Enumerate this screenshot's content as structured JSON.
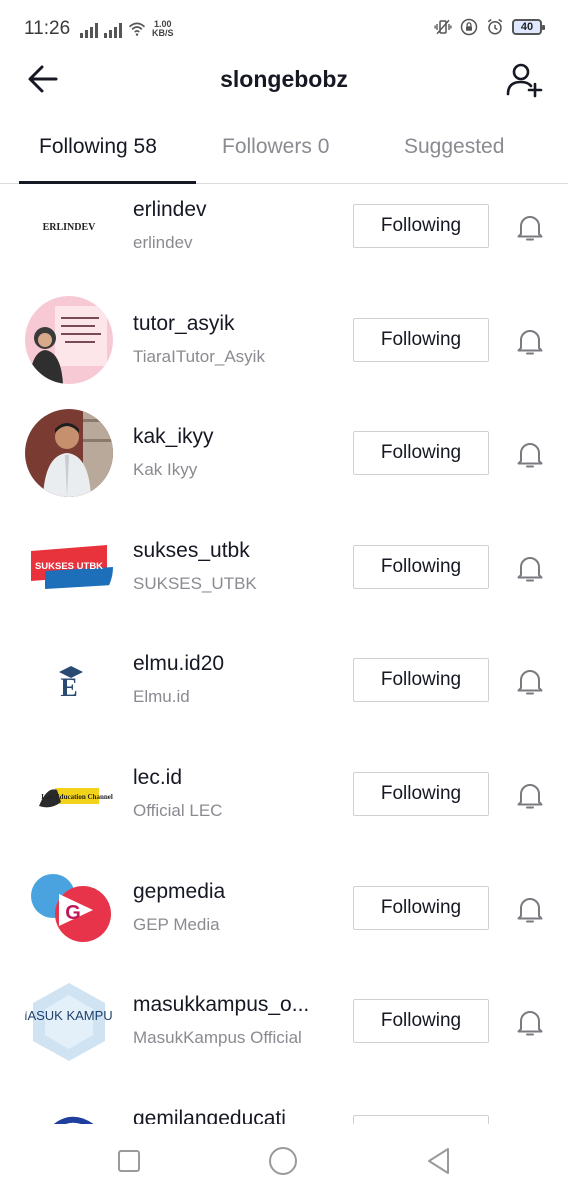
{
  "status_bar": {
    "time": "11:26",
    "net_speed_value": "1.00",
    "net_speed_unit": "KB/S",
    "battery": "40",
    "icons": [
      "signal-icon",
      "signal-icon",
      "wifi-icon",
      "vibrate-icon",
      "lock-icon",
      "alarm-icon",
      "battery-icon"
    ]
  },
  "header": {
    "title": "slongebobz",
    "back_icon": "arrow-left-icon",
    "add_icon": "add-friend-icon"
  },
  "tabs": [
    {
      "label": "Following 58",
      "active": true
    },
    {
      "label": "Followers 0",
      "active": false
    },
    {
      "label": "Suggested",
      "active": false
    }
  ],
  "following_button_label": "Following",
  "users": [
    {
      "username": "erlindev",
      "display_name": "erlindev",
      "avatar": "erlindev-logo",
      "avatar_text": "ERLINDEV"
    },
    {
      "username": "tutor_asyik",
      "display_name": "TiaraITutor_Asyik",
      "avatar": "tutor-photo",
      "avatar_text": ""
    },
    {
      "username": "kak_ikyy",
      "display_name": "Kak Ikyy",
      "avatar": "person-photo",
      "avatar_text": ""
    },
    {
      "username": "sukses_utbk",
      "display_name": "SUKSES_UTBK",
      "avatar": "sukses-utbk-logo",
      "avatar_text": "SUKSES UTBK"
    },
    {
      "username": "elmu.id20",
      "display_name": "Elmu.id",
      "avatar": "elmu-logo",
      "avatar_text": "E"
    },
    {
      "username": "lec.id",
      "display_name": "Official LEC",
      "avatar": "lec-logo",
      "avatar_text": "Lab Education Channel"
    },
    {
      "username": "gepmedia",
      "display_name": "GEP Media",
      "avatar": "gep-logo",
      "avatar_text": "G"
    },
    {
      "username": "masukkampus_o...",
      "display_name": "MasukKampus Official",
      "avatar": "masukkampus-logo",
      "avatar_text": "MASUK KAMPUS"
    },
    {
      "username": "gemilangeducati",
      "display_name": "",
      "avatar": "gemilang-logo",
      "avatar_text": ""
    }
  ],
  "nav_bar": {
    "buttons": [
      "recents-square-icon",
      "home-circle-icon",
      "back-triangle-icon"
    ]
  }
}
